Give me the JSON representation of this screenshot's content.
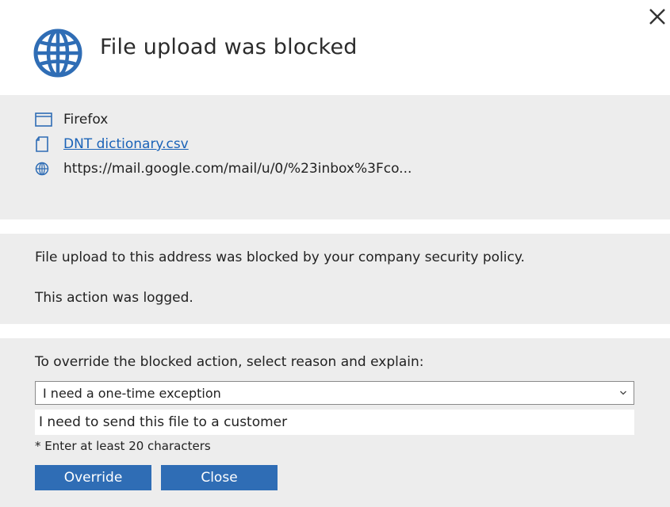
{
  "dialog": {
    "title": "File upload was blocked"
  },
  "details": {
    "app": "Firefox",
    "file": "DNT dictionary.csv",
    "url": "https://mail.google.com/mail/u/0/%23inbox%3Fco..."
  },
  "message": {
    "line1": "File upload to this address was blocked by your company security policy.",
    "line2": "This action was logged."
  },
  "override": {
    "prompt": "To override the blocked action, select reason and explain:",
    "reason_selected": "I need a one-time exception",
    "explanation_value": "I need to send this file to a customer",
    "hint": "* Enter at least 20 characters",
    "override_label": "Override",
    "close_label": "Close"
  },
  "colors": {
    "accent": "#2f6db5",
    "link": "#1b63b8",
    "panel": "#ededed",
    "globe": "#2f6db5"
  },
  "icons": {
    "header": "globe-icon",
    "close": "close-icon",
    "app": "window-icon",
    "file": "document-icon",
    "url": "globe-icon",
    "select": "chevron-down-icon"
  }
}
